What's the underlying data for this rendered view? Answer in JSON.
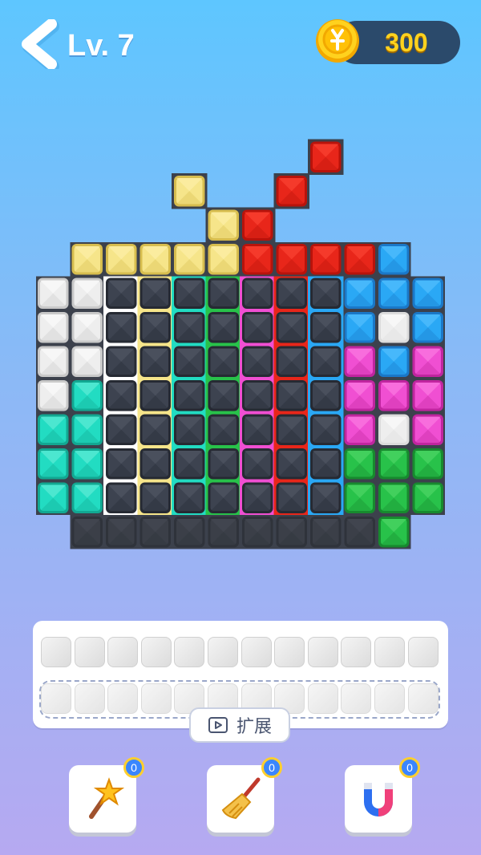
{
  "header": {
    "level_label": "Lv. 7",
    "coins": "300"
  },
  "board": {
    "top_blocks": [
      {
        "color": "red"
      },
      {
        "color": "yellow"
      },
      {
        "color": "red"
      },
      {
        "color": "yellow"
      },
      {
        "color": "red"
      }
    ],
    "rows": [
      [
        "empty",
        "yellow",
        "yellow",
        "yellow",
        "yellow",
        "yellow",
        "red",
        "red",
        "red",
        "red",
        "blue",
        "empty"
      ],
      [
        "white",
        "white",
        "dark",
        "dark",
        "dark",
        "dark",
        "dark",
        "dark",
        "dark",
        "blue",
        "blue",
        "blue"
      ],
      [
        "white",
        "white",
        "dark",
        "dark",
        "dark",
        "dark",
        "dark",
        "dark",
        "dark",
        "blue",
        "lightwhite",
        "blue"
      ],
      [
        "white",
        "white",
        "dark",
        "dark",
        "dark",
        "dark",
        "dark",
        "dark",
        "dark",
        "pink",
        "blue",
        "pink"
      ],
      [
        "white",
        "teal",
        "dark",
        "dark",
        "dark",
        "dark",
        "dark",
        "dark",
        "dark",
        "pink",
        "pink",
        "pink"
      ],
      [
        "teal",
        "teal",
        "dark",
        "dark",
        "dark",
        "dark",
        "dark",
        "dark",
        "dark",
        "pink",
        "lightwhite",
        "pink"
      ],
      [
        "teal",
        "teal",
        "dark",
        "dark",
        "dark",
        "dark",
        "dark",
        "dark",
        "dark",
        "green",
        "green",
        "green"
      ],
      [
        "teal",
        "teal",
        "dark",
        "dark",
        "dark",
        "dark",
        "dark",
        "dark",
        "dark",
        "green",
        "green",
        "green"
      ],
      [
        "empty",
        "dim",
        "dim",
        "dim",
        "dim",
        "dim",
        "dim",
        "dim",
        "dim",
        "dim",
        "green",
        "empty"
      ]
    ],
    "column_stripes": [
      "white",
      "yellow",
      "teal",
      "green",
      "pink",
      "red",
      "blue"
    ]
  },
  "tray": {
    "row1_slots": 12,
    "row2_slots": 12
  },
  "expand_button": {
    "label": "扩展",
    "icon": "video-icon"
  },
  "boosters": [
    {
      "name": "magic-wand",
      "icon": "star-wand-icon",
      "count": "0"
    },
    {
      "name": "broom",
      "icon": "broom-icon",
      "count": "0"
    },
    {
      "name": "magnet",
      "icon": "magnet-icon",
      "count": "0"
    }
  ],
  "colors": {
    "red": "#e8261a",
    "yellow": "#f6e58a",
    "blue": "#2aa8f5",
    "white": "#eeeeee",
    "teal": "#22dcc2",
    "pink": "#f04fd2",
    "green": "#28c24a",
    "dark": "#3d4350",
    "dim": "#3b3f48",
    "board_bg": "#3c414c",
    "coin": "#ffd21e"
  }
}
